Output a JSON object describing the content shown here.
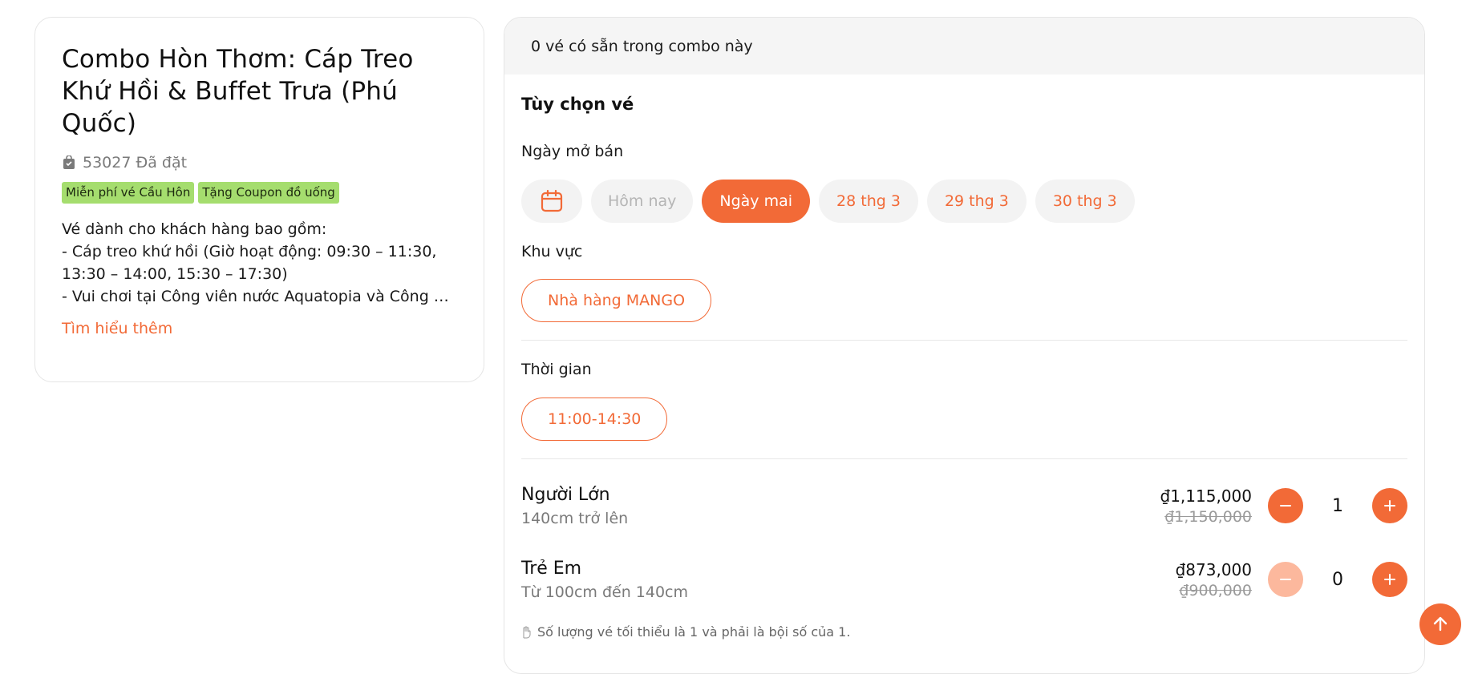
{
  "product": {
    "title": "Combo Hòn Thơm: Cáp Treo Khứ Hồi & Buffet Trưa (Phú Quốc)",
    "booked": "53027 Đã đặt",
    "tags": [
      "Miễn phí vé Cầu Hôn",
      "Tặng Coupon đồ uống"
    ],
    "description": [
      "Vé dành cho khách hàng bao gồm:",
      "- Cáp treo khứ hồi (Giờ hoạt động: 09:30 – 11:30,",
      "13:30 – 14:00, 15:30 – 17:30)",
      "- Vui chơi tại Công viên nước Aquatopia và Công viên nước Aquatopia"
    ],
    "learn_more": "Tìm hiểu thêm"
  },
  "booking": {
    "availability": "0 vé có sẵn trong combo này",
    "options_title": "Tùy chọn vé",
    "date_label": "Ngày mở bán",
    "dates": [
      {
        "label": "Hôm nay",
        "state": "disabled"
      },
      {
        "label": "Ngày mai",
        "state": "active"
      },
      {
        "label": "28 thg 3",
        "state": "normal"
      },
      {
        "label": "29 thg 3",
        "state": "normal"
      },
      {
        "label": "30 thg 3",
        "state": "normal"
      }
    ],
    "zone_label": "Khu vực",
    "zone_value": "Nhà hàng MANGO",
    "time_label": "Thời gian",
    "time_value": "11:00-14:30",
    "tickets": [
      {
        "name": "Người Lớn",
        "sub": "140cm trở lên",
        "price": "₫1,115,000",
        "old_price": "₫1,150,000",
        "qty": "1"
      },
      {
        "name": "Trẻ Em",
        "sub": "Từ 100cm đến 140cm",
        "price": "₫873,000",
        "old_price": "₫900,000",
        "qty": "0"
      }
    ],
    "note": "Số lượng vé tối thiểu là 1 và phải là bội số của 1."
  },
  "colors": {
    "accent": "#f26a37",
    "tag_bg": "#a5dd6e"
  },
  "icons": [
    "bag-icon",
    "calendar-icon",
    "minus-icon",
    "plus-icon",
    "hand-icon",
    "arrow-up-icon"
  ]
}
